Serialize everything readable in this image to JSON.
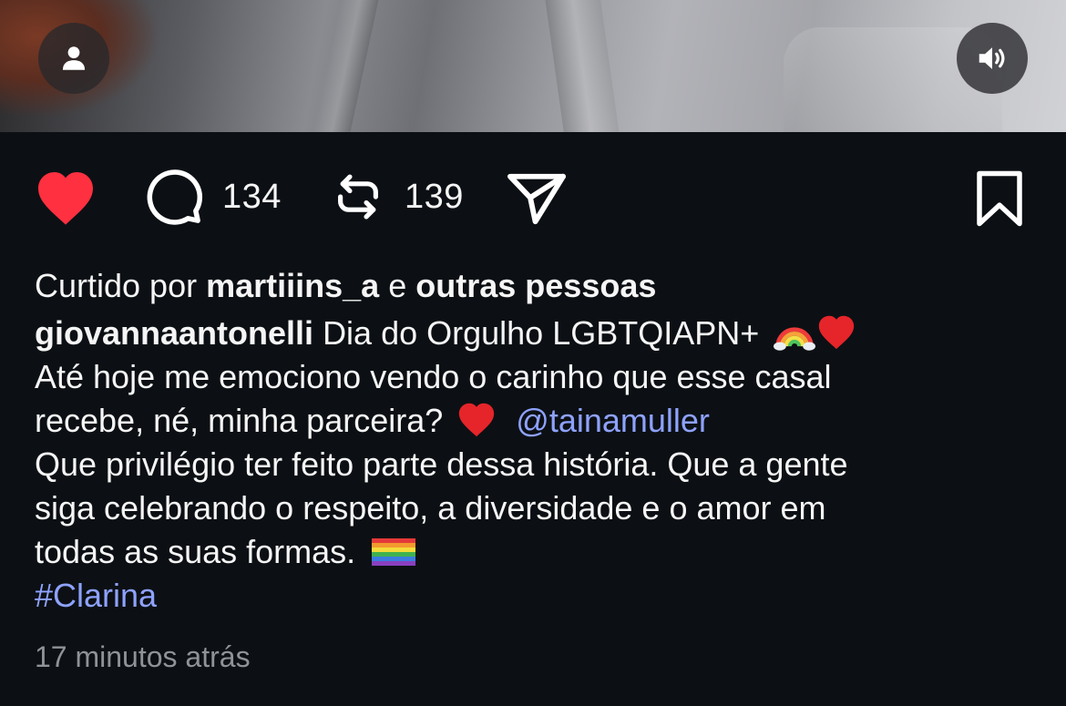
{
  "post": {
    "likes_text": {
      "prefix": "Curtido por",
      "liker": "martiiins_a",
      "joiner": "e",
      "others": "outras pessoas"
    },
    "caption": {
      "username": "giovannaantonelli",
      "line1_text": "Dia do Orgulho LGBTQIAPN+",
      "line2": "Até hoje me emociono vendo o carinho que esse casal",
      "line3_text": "recebe, né, minha parceira?",
      "mention": "@tainamuller",
      "line4": "Que privilégio ter feito parte dessa história. Que a gente",
      "line5": "siga celebrando o respeito, a diversidade e o amor em",
      "line6_text": "todas as suas formas.",
      "hashtag": "#Clarina"
    },
    "timestamp": "17 minutos atrás"
  },
  "actions": {
    "comment_count": "134",
    "repost_count": "139"
  },
  "icons": {
    "like": "heart-filled-icon",
    "comment": "comment-bubble-icon",
    "repost": "repost-arrows-icon",
    "share": "paper-plane-icon",
    "save": "bookmark-icon",
    "profile": "person-icon",
    "sound": "speaker-icon"
  },
  "colors": {
    "background": "#0c1014",
    "like_red": "#ff3040",
    "link_blue": "#8ea2ff",
    "muted": "#8f9296"
  }
}
